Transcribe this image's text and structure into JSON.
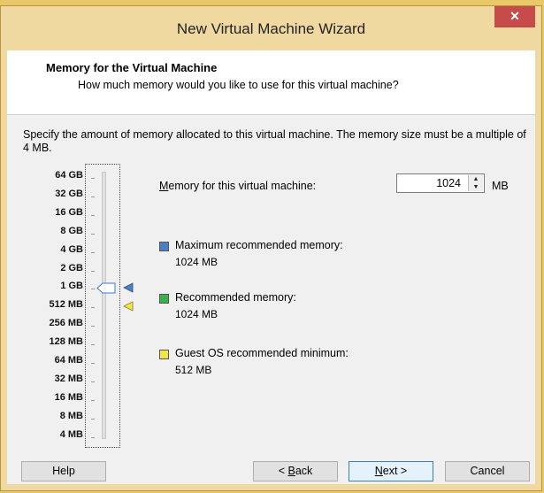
{
  "window": {
    "title": "New Virtual Machine Wizard",
    "close_glyph": "✕"
  },
  "header": {
    "title": "Memory for the Virtual Machine",
    "subtitle": "How much memory would you like to use for this virtual machine?"
  },
  "description": "Specify the amount of memory allocated to this virtual machine. The memory size must be a multiple of 4 MB.",
  "scale_labels": [
    "64 GB",
    "32 GB",
    "16 GB",
    "8 GB",
    "4 GB",
    "2 GB",
    "1 GB",
    "512 MB",
    "256 MB",
    "128 MB",
    "64 MB",
    "32 MB",
    "16 MB",
    "8 MB",
    "4 MB"
  ],
  "slider": {
    "selected_label": "1 GB"
  },
  "memory": {
    "label": "Memory for this virtual machine:",
    "value": "1024",
    "unit": "MB"
  },
  "legend": [
    {
      "title": "Maximum recommended memory:",
      "value": "1024 MB",
      "color": "#4a7fc0",
      "icon": "blue-square-icon"
    },
    {
      "title": "Recommended memory:",
      "value": "1024 MB",
      "color": "#36b24a",
      "icon": "green-square-icon"
    },
    {
      "title": "Guest OS recommended minimum:",
      "value": "512 MB",
      "color": "#f2e54a",
      "icon": "yellow-square-icon"
    }
  ],
  "buttons": {
    "help": "Help",
    "back": "< Back",
    "next": "Next >",
    "cancel": "Cancel"
  }
}
